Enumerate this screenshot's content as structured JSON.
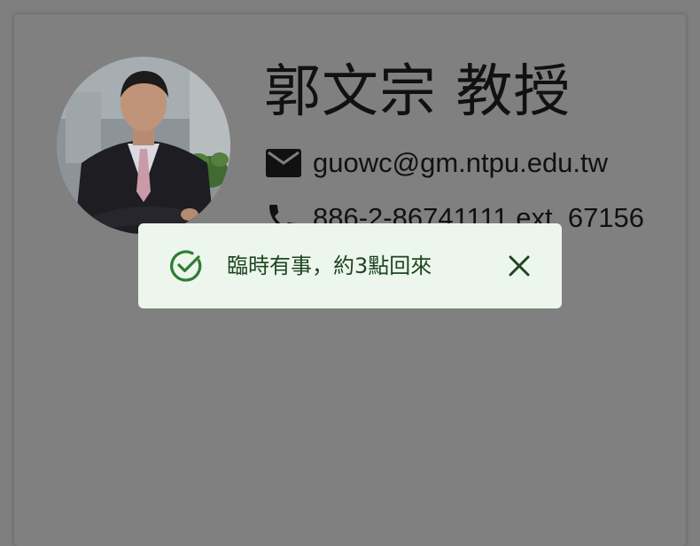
{
  "profile": {
    "name": "郭文宗 教授",
    "email": "guowc@gm.ntpu.edu.tw",
    "phone": "886-2-86741111 ext. 67156",
    "photo_alt": "profile-photo"
  },
  "toast": {
    "message": "臨時有事，約3點回來",
    "severity": "success"
  },
  "icons": {
    "email": "mail-icon",
    "phone": "phone-icon",
    "success": "check-circle-icon",
    "close": "close-icon"
  },
  "colors": {
    "overlay_background": "#7f7f7f",
    "toast_background": "#edf6ed",
    "toast_text": "#1e4620",
    "toast_icon": "#2e7d32"
  }
}
